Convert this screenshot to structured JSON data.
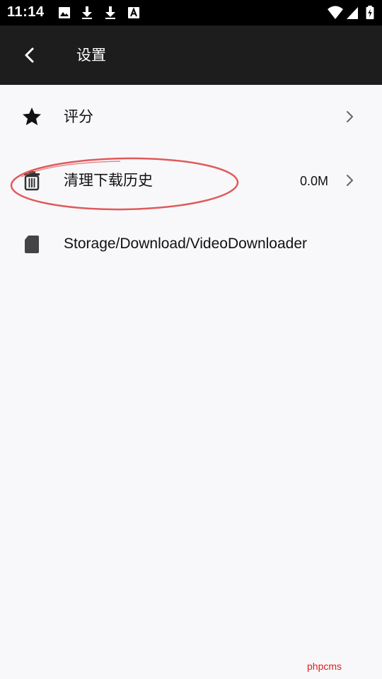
{
  "status_bar": {
    "time": "11:14",
    "left_icons": [
      "image-icon",
      "download-icon",
      "download-icon",
      "text-a-icon"
    ],
    "right_icons": [
      "wifi-icon",
      "cell-signal-icon",
      "battery-charging-icon"
    ]
  },
  "app_bar": {
    "back_icon": "back-arrow-icon",
    "title": "设置"
  },
  "settings": {
    "rate": {
      "label": "评分",
      "icon": "star-icon"
    },
    "clear_history": {
      "label": "清理下载历史",
      "value": "0.0M",
      "icon": "trash-icon"
    },
    "storage": {
      "label": "Storage/Download/VideoDownloader",
      "icon": "sd-card-icon"
    }
  },
  "annotation": {
    "shape": "ellipse",
    "color": "#e05a5a"
  },
  "watermark": "phpcms",
  "colors": {
    "status_bar": "#000000",
    "app_bar": "#1d1d1d",
    "background": "#f8f8fa",
    "icon_dark": "#111111",
    "chevron": "#666666",
    "watermark": "#e02020"
  }
}
